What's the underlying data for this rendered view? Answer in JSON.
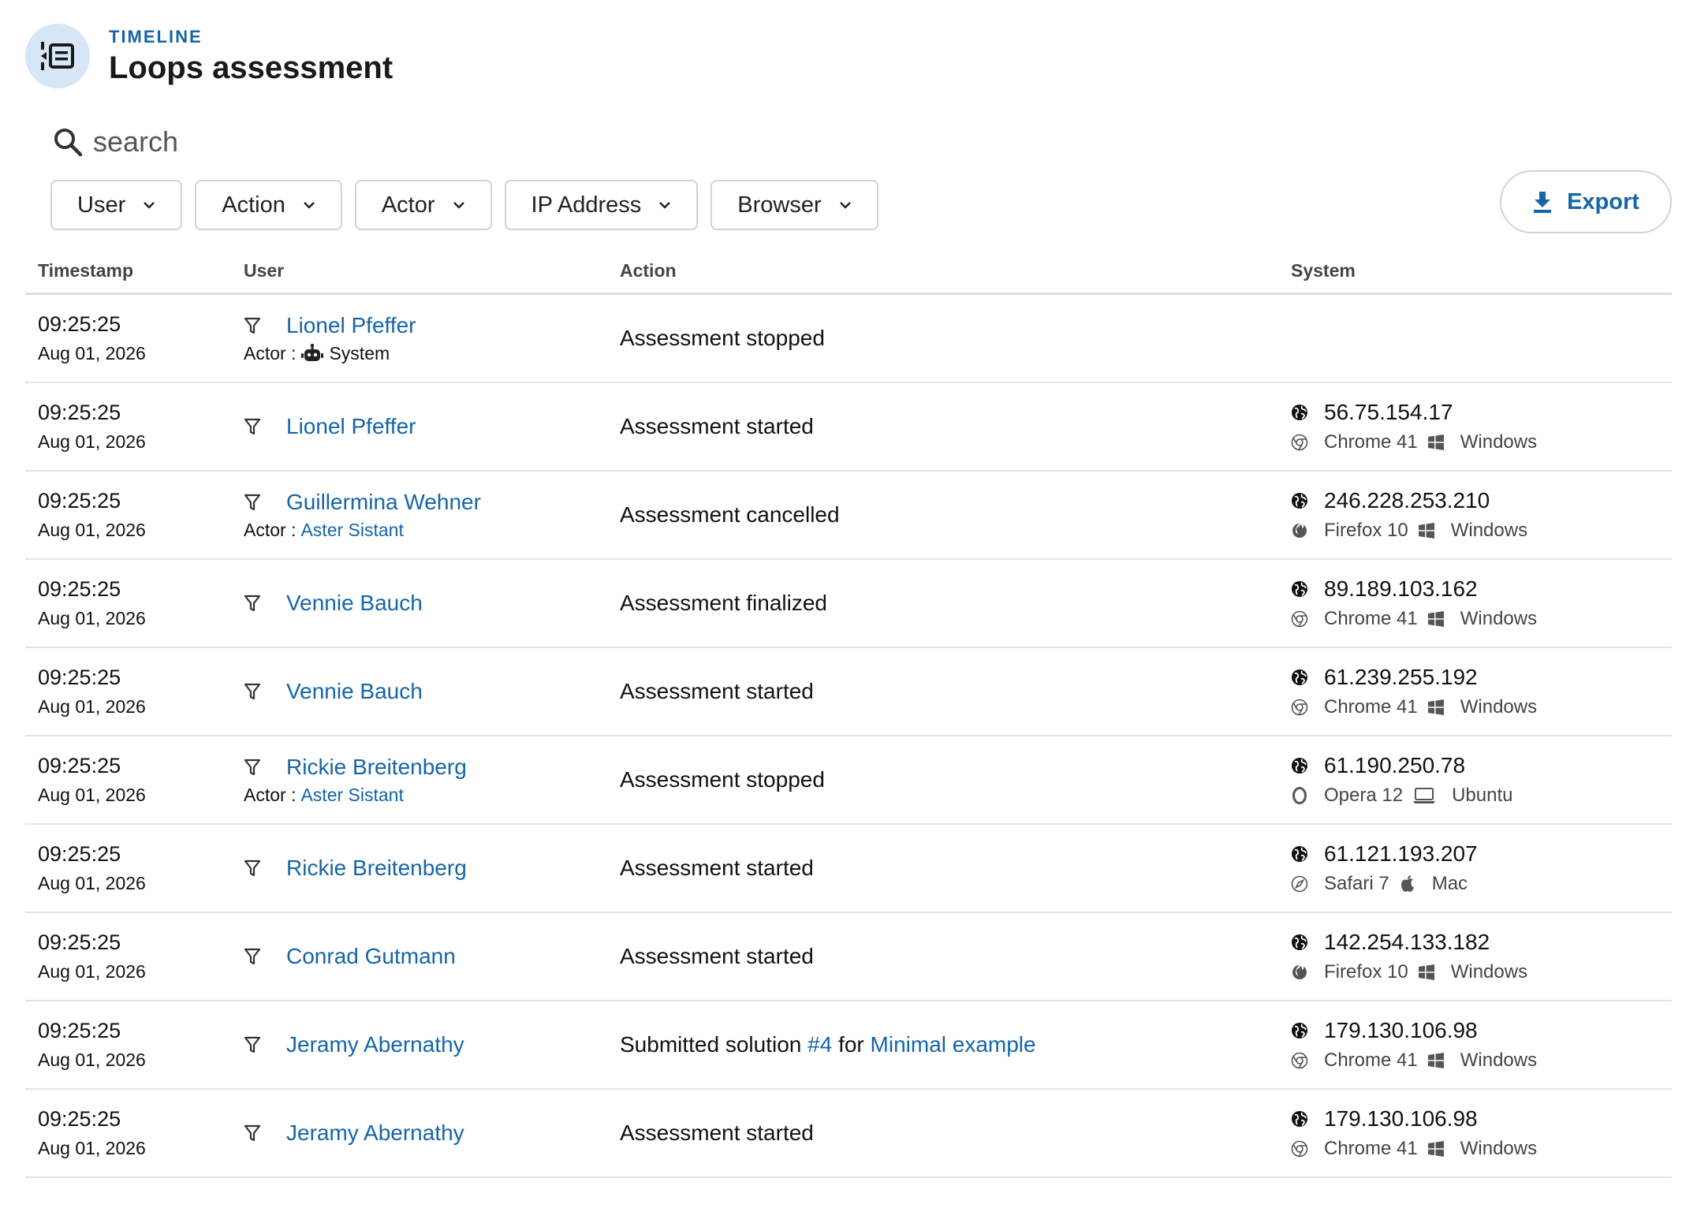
{
  "header": {
    "overline": "TIMELINE",
    "title": "Loops assessment",
    "icon": "timeline-icon"
  },
  "search": {
    "placeholder": "search",
    "value": ""
  },
  "filters": [
    "User",
    "Action",
    "Actor",
    "IP Address",
    "Browser"
  ],
  "export_label": "Export",
  "columns": {
    "timestamp": "Timestamp",
    "user": "User",
    "action": "Action",
    "system": "System"
  },
  "actor_prefix": "Actor :",
  "colors": {
    "accent": "#1565a8",
    "header_icon_bg": "#d6e6f7"
  },
  "rows": [
    {
      "time": "09:25:25",
      "date": "Aug 01, 2026",
      "user": "Lionel Pfeffer",
      "actor": "System",
      "actor_type": "system",
      "action": "Assessment stopped",
      "ip": "",
      "browser": "",
      "os": ""
    },
    {
      "time": "09:25:25",
      "date": "Aug 01, 2026",
      "user": "Lionel Pfeffer",
      "actor": "",
      "action": "Assessment started",
      "ip": "56.75.154.17",
      "browser": "Chrome 41",
      "browser_icon": "chrome",
      "os": "Windows",
      "os_icon": "windows"
    },
    {
      "time": "09:25:25",
      "date": "Aug 01, 2026",
      "user": "Guillermina Wehner",
      "actor": "Aster Sistant",
      "actor_type": "user",
      "action": "Assessment cancelled",
      "ip": "246.228.253.210",
      "browser": "Firefox 10",
      "browser_icon": "firefox",
      "os": "Windows",
      "os_icon": "windows"
    },
    {
      "time": "09:25:25",
      "date": "Aug 01, 2026",
      "user": "Vennie Bauch",
      "actor": "",
      "action": "Assessment finalized",
      "ip": "89.189.103.162",
      "browser": "Chrome 41",
      "browser_icon": "chrome",
      "os": "Windows",
      "os_icon": "windows"
    },
    {
      "time": "09:25:25",
      "date": "Aug 01, 2026",
      "user": "Vennie Bauch",
      "actor": "",
      "action": "Assessment started",
      "ip": "61.239.255.192",
      "browser": "Chrome 41",
      "browser_icon": "chrome",
      "os": "Windows",
      "os_icon": "windows"
    },
    {
      "time": "09:25:25",
      "date": "Aug 01, 2026",
      "user": "Rickie Breitenberg",
      "actor": "Aster Sistant",
      "actor_type": "user",
      "action": "Assessment stopped",
      "ip": "61.190.250.78",
      "browser": "Opera 12",
      "browser_icon": "opera",
      "os": "Ubuntu",
      "os_icon": "laptop"
    },
    {
      "time": "09:25:25",
      "date": "Aug 01, 2026",
      "user": "Rickie Breitenberg",
      "actor": "",
      "action": "Assessment started",
      "ip": "61.121.193.207",
      "browser": "Safari 7",
      "browser_icon": "safari",
      "os": "Mac",
      "os_icon": "apple"
    },
    {
      "time": "09:25:25",
      "date": "Aug 01, 2026",
      "user": "Conrad Gutmann",
      "actor": "",
      "action": "Assessment started",
      "ip": "142.254.133.182",
      "browser": "Firefox 10",
      "browser_icon": "firefox",
      "os": "Windows",
      "os_icon": "windows"
    },
    {
      "time": "09:25:25",
      "date": "Aug 01, 2026",
      "user": "Jeramy Abernathy",
      "actor": "",
      "action_parts": [
        "Submitted solution ",
        "#4",
        " for ",
        "Minimal example"
      ],
      "ip": "179.130.106.98",
      "browser": "Chrome 41",
      "browser_icon": "chrome",
      "os": "Windows",
      "os_icon": "windows"
    },
    {
      "time": "09:25:25",
      "date": "Aug 01, 2026",
      "user": "Jeramy Abernathy",
      "actor": "",
      "action": "Assessment started",
      "ip": "179.130.106.98",
      "browser": "Chrome 41",
      "browser_icon": "chrome",
      "os": "Windows",
      "os_icon": "windows"
    }
  ]
}
